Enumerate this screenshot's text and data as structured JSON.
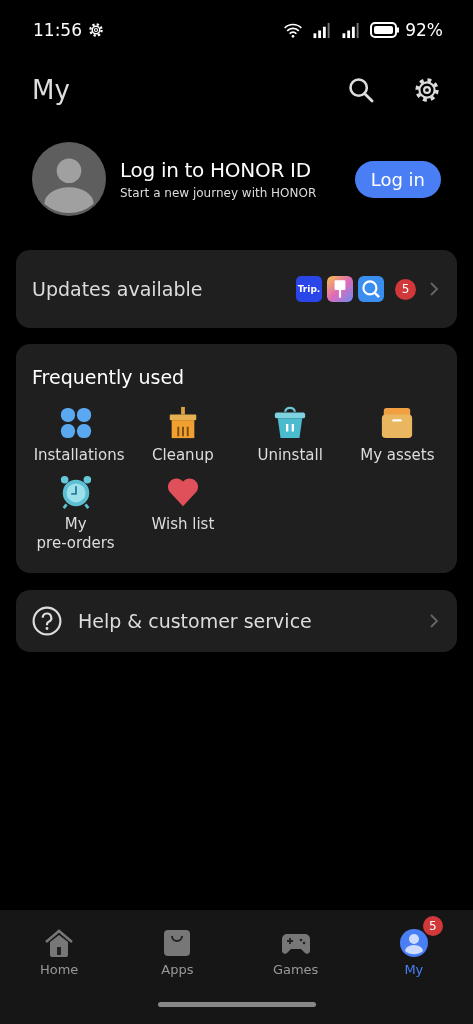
{
  "status_bar": {
    "time": "11:56",
    "battery": "92%"
  },
  "header": {
    "title": "My"
  },
  "profile": {
    "title": "Log in to HONOR ID",
    "subtitle": "Start a new journey with HONOR",
    "button": "Log in"
  },
  "updates": {
    "label": "Updates available",
    "app_icons": [
      {
        "kind": "trip",
        "text": "Trip."
      },
      {
        "kind": "brush"
      },
      {
        "kind": "search"
      }
    ],
    "count": "5"
  },
  "frequently_used": {
    "title": "Frequently used",
    "items": [
      {
        "kind": "installations",
        "label": "Installations"
      },
      {
        "kind": "cleanup",
        "label": "Cleanup"
      },
      {
        "kind": "uninstall",
        "label": "Uninstall"
      },
      {
        "kind": "assets",
        "label": "My assets"
      },
      {
        "kind": "preorders",
        "label": "My pre-orders"
      },
      {
        "kind": "wishlist",
        "label": "Wish list"
      }
    ]
  },
  "help": {
    "label": "Help & customer service"
  },
  "bottom_nav": [
    {
      "kind": "home",
      "label": "Home",
      "selected": false
    },
    {
      "kind": "apps",
      "label": "Apps",
      "selected": false
    },
    {
      "kind": "games",
      "label": "Games",
      "selected": false
    },
    {
      "kind": "my",
      "label": "My",
      "selected": true,
      "badge": "5"
    }
  ]
}
